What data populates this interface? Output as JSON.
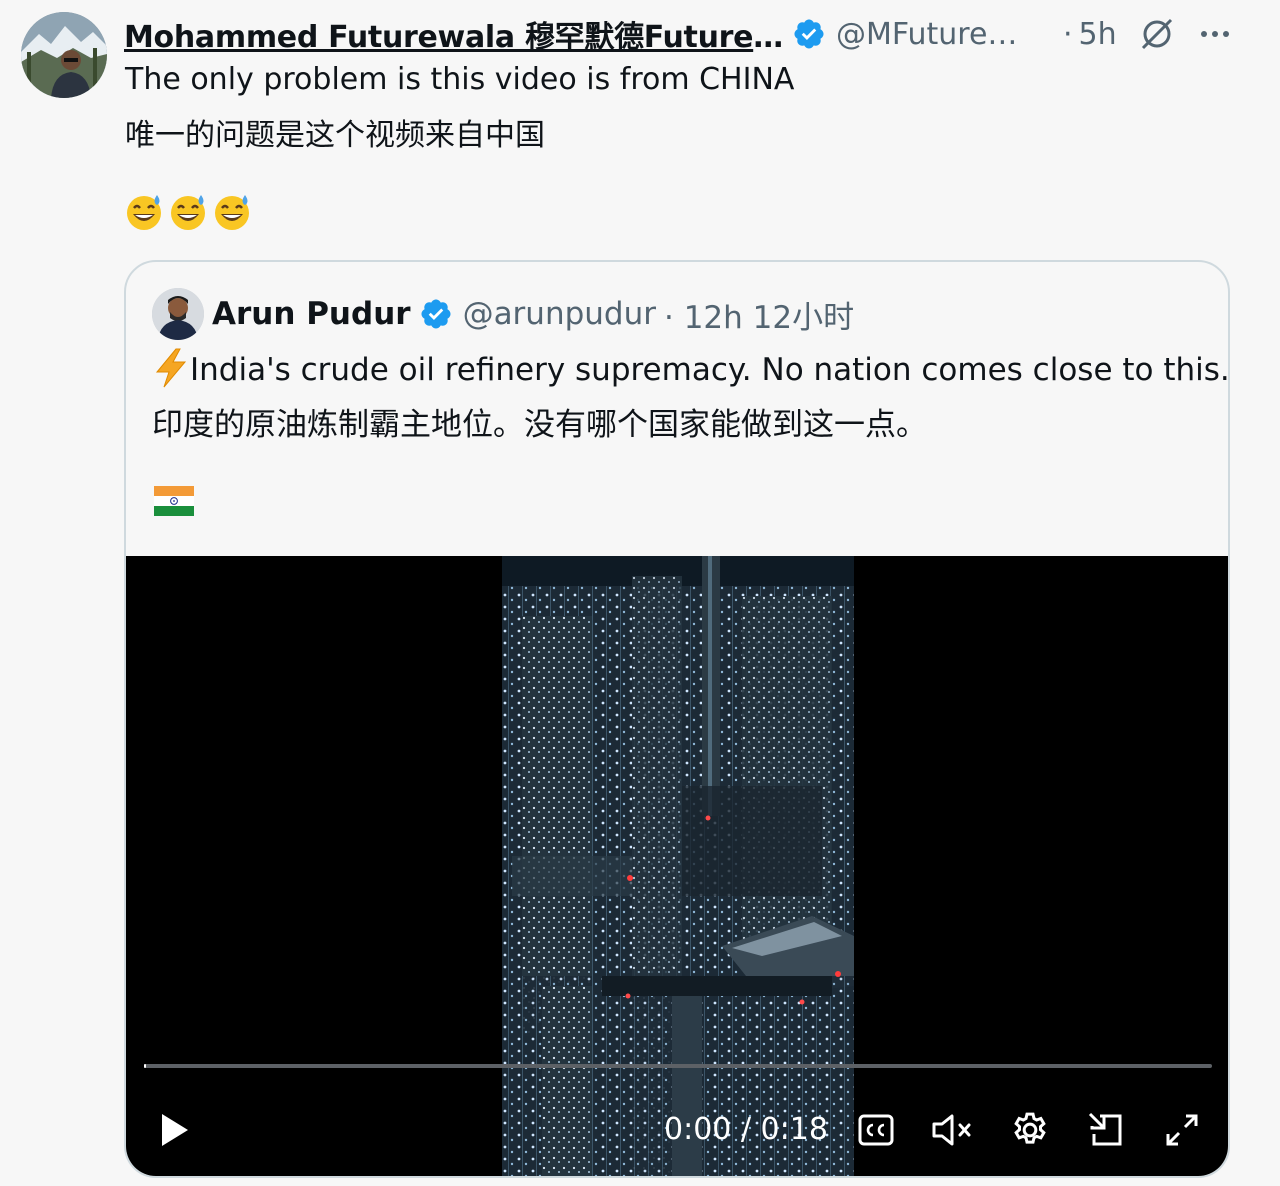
{
  "post": {
    "author_name": "Mohammed Futurewala 穆罕默德Futurewala",
    "author_handle": "@MFuturewala",
    "separator": "·",
    "time": "5h",
    "text_en": "The only problem is this video is from CHINA",
    "text_zh": "唯一的问题是这个视频来自中国",
    "emojis": [
      "grinning-face-with-sweat",
      "grinning-face-with-sweat",
      "grinning-face-with-sweat"
    ]
  },
  "quoted": {
    "author_name": "Arun Pudur",
    "author_handle": "@arunpudur",
    "time": "· 12h 12小时",
    "text_en": "India's crude oil refinery supremacy. No nation comes close to this.",
    "text_zh": "印度的原油炼制霸主地位。没有哪个国家能做到这一点。",
    "flag_icon": "india-flag-icon",
    "bolt_icon": "high-voltage-icon"
  },
  "video": {
    "timecode": "0:00 / 0:18",
    "progress": 0.0,
    "muted": true,
    "controls": [
      "play-icon",
      "captions-icon",
      "mute-icon",
      "settings-icon",
      "pip-icon",
      "fullscreen-icon"
    ]
  },
  "colors": {
    "verified": "#1d9bf0",
    "secondary_text": "#536471",
    "background": "#f7f7f7",
    "border": "#cfd9de"
  }
}
